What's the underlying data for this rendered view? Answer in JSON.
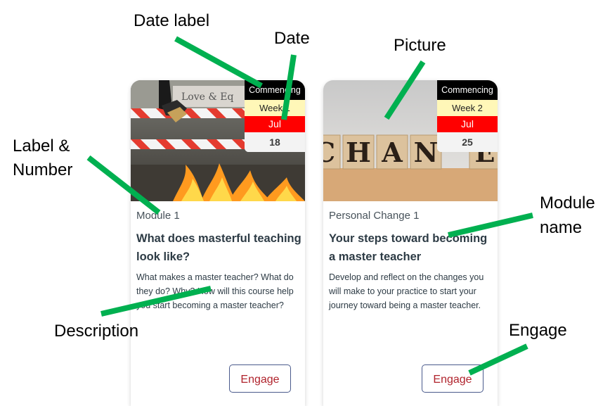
{
  "annotations": {
    "date_label": "Date label",
    "date": "Date",
    "picture": "Picture",
    "label_number_line1": "Label &",
    "label_number_line2": "Number",
    "module_name_line1": "Module",
    "module_name_line2": "name",
    "description": "Description",
    "engage": "Engage"
  },
  "annotation_color": "#00b050",
  "cards": [
    {
      "picture_icon": "fire-hurdle-photo",
      "date_label": "Commencing",
      "week": "Week 1",
      "month": "Jul",
      "day": "18",
      "label": "Module 1",
      "title": "What does masterful teaching look like?",
      "description": "What makes a master teacher? What do they do? Why? How will this course help you start becoming a master teacher?",
      "button": "Engage"
    },
    {
      "picture_icon": "change-blocks-photo",
      "picture_text": "CHAN E",
      "date_label": "Commencing",
      "week": "Week 2",
      "month": "Jul",
      "day": "25",
      "label": "Personal Change 1",
      "title": "Your steps toward becoming a master teacher",
      "description": "Develop and reflect on the changes you will make to your practice to start your journey toward being a master teacher.",
      "button": "Engage"
    }
  ],
  "colors": {
    "date_label_bg": "#000000",
    "week_bg": "#fff7b8",
    "month_bg": "#ff0000",
    "engage_text": "#b0232c",
    "engage_border": "#4a5a8c"
  }
}
